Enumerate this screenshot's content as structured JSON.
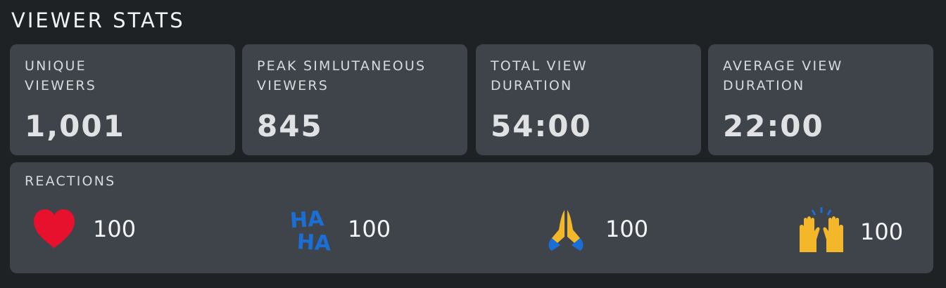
{
  "header": {
    "title": "VIEWER STATS"
  },
  "stats": [
    {
      "label": "UNIQUE\nVIEWERS",
      "value": "1,001"
    },
    {
      "label": "PEAK SIMLUTANEOUS\nVIEWERS",
      "value": "845"
    },
    {
      "label": "TOTAL VIEW\nDURATION",
      "value": "54:00"
    },
    {
      "label": "AVERAGE VIEW\nDURATION",
      "value": "22:00"
    }
  ],
  "reactions": {
    "label": "REACTIONS",
    "items": [
      {
        "icon": "heart-icon",
        "count": "100",
        "color": "#e8112d"
      },
      {
        "icon": "haha-icon",
        "count": "100",
        "color": "#1a6fd6"
      },
      {
        "icon": "praying-hands-icon",
        "count": "100",
        "color": "#f4b72a"
      },
      {
        "icon": "raised-hands-icon",
        "count": "100",
        "color": "#f4b72a"
      }
    ]
  }
}
